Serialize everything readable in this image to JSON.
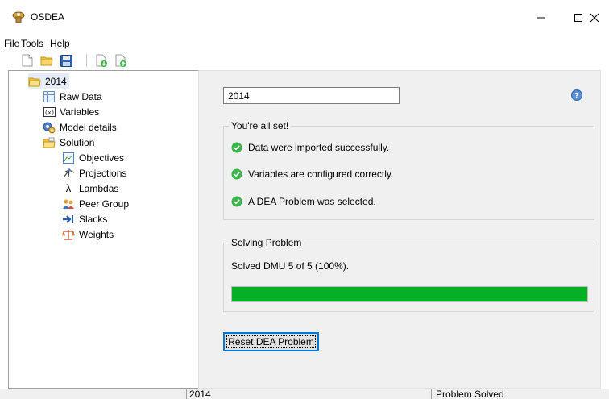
{
  "window": {
    "title": "OSDEA"
  },
  "menu": {
    "items": [
      {
        "label": "File",
        "accel": "F",
        "rest": "ile"
      },
      {
        "label": "Tools",
        "accel": "T",
        "rest": "ools"
      },
      {
        "label": "Help",
        "accel": "H",
        "rest": "elp"
      }
    ]
  },
  "toolbar": {
    "icons": [
      "new-file-icon",
      "open-folder-icon",
      "save-icon",
      "import-icon",
      "export-icon"
    ]
  },
  "tree": {
    "root": "2014",
    "items": [
      "Raw Data",
      "Variables",
      "Model details",
      "Solution"
    ],
    "solution_children": [
      "Objectives",
      "Projections",
      "Lambdas",
      "Peer Group",
      "Slacks",
      "Weights"
    ]
  },
  "main": {
    "title_value": "2014",
    "all_set": {
      "legend": "You're all set!",
      "checks": [
        "Data were imported successfully.",
        "Variables are configured correctly.",
        "A DEA Problem was selected."
      ]
    },
    "solving": {
      "legend": "Solving Problem",
      "status": "Solved DMU 5 of 5 (100%).",
      "progress_percent": 100
    },
    "reset_label": "Reset DEA Problem"
  },
  "statusbar": {
    "left": "2014",
    "right": "Problem Solved"
  },
  "colors": {
    "progress": "#06b025",
    "check": "#3db54a",
    "accent": "#0078d7"
  }
}
